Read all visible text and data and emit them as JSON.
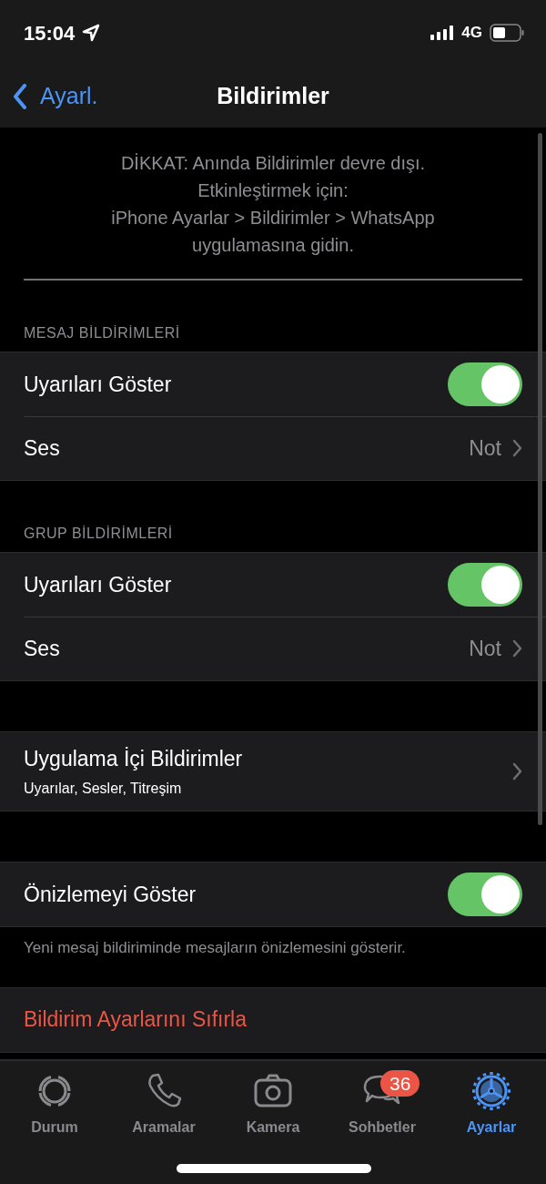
{
  "status_bar": {
    "time": "15:04",
    "network": "4G"
  },
  "nav": {
    "back": "Ayarl.",
    "title": "Bildirimler"
  },
  "notice": "DİKKAT: Anında Bildirimler devre dışı.\nEtkinleştirmek için:\niPhone Ayarlar > Bildirimler > WhatsApp\nuygulamasına gidin.",
  "sections": [
    {
      "header": "MESAJ BİLDİRİMLERİ",
      "rows": [
        {
          "kind": "toggle",
          "label": "Uyarıları Göster",
          "on": true
        },
        {
          "kind": "value",
          "label": "Ses",
          "value": "Not"
        }
      ]
    },
    {
      "header": "GRUP BİLDİRİMLERİ",
      "rows": [
        {
          "kind": "toggle",
          "label": "Uyarıları Göster",
          "on": true
        },
        {
          "kind": "value",
          "label": "Ses",
          "value": "Not"
        }
      ]
    },
    {
      "rows": [
        {
          "kind": "nav",
          "label": "Uygulama İçi Bildirimler",
          "subtitle": "Uyarılar, Sesler, Titreşim"
        }
      ]
    },
    {
      "rows": [
        {
          "kind": "toggle",
          "label": "Önizlemeyi Göster",
          "on": true
        }
      ],
      "footer": "Yeni mesaj bildiriminde mesajların önizlemesini gösterir."
    },
    {
      "rows": [
        {
          "kind": "action",
          "label": "Bildirim Ayarlarını Sıfırla"
        }
      ]
    }
  ],
  "tabs": [
    {
      "label": "Durum",
      "selected": false
    },
    {
      "label": "Aramalar",
      "selected": false
    },
    {
      "label": "Kamera",
      "selected": false
    },
    {
      "label": "Sohbetler",
      "selected": false,
      "badge": "36"
    },
    {
      "label": "Ayarlar",
      "selected": true
    }
  ]
}
